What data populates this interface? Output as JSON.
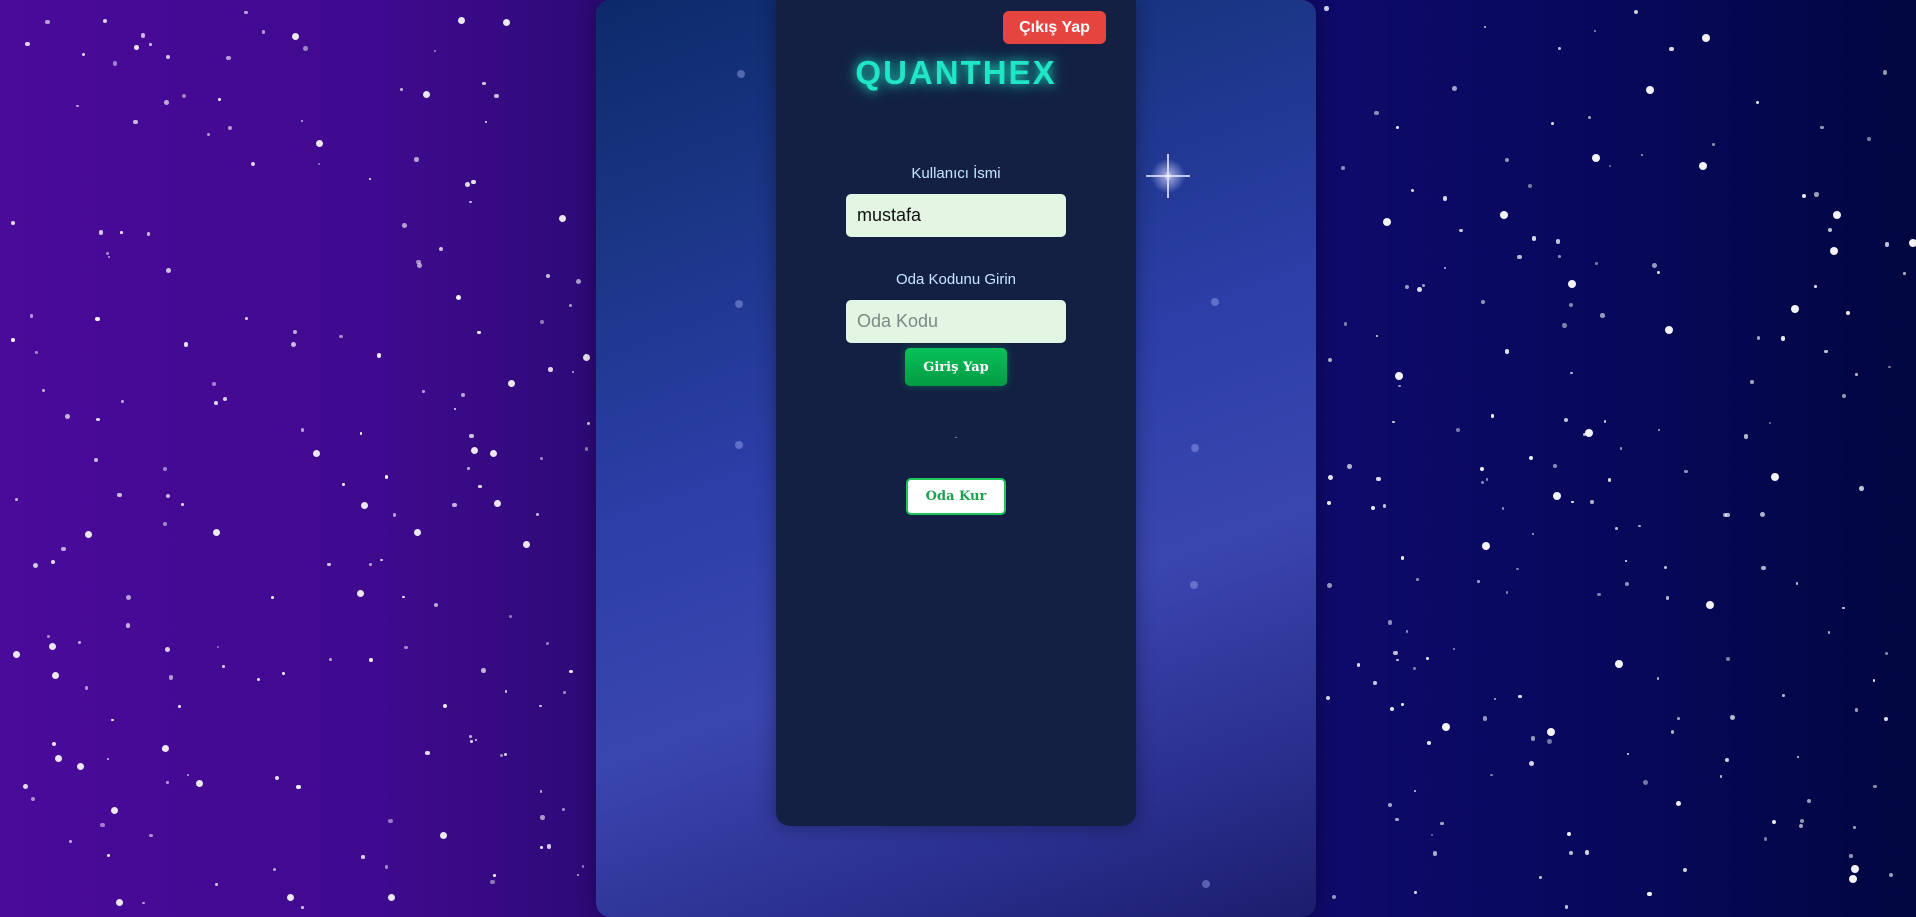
{
  "app": {
    "brand": "QUANTHEX"
  },
  "header": {
    "logout_label": "Çıkış Yap"
  },
  "form": {
    "username_label": "Kullanıcı İsmi",
    "username_value": "mustafa",
    "room_code_label": "Oda Kodunu Girin",
    "room_code_placeholder": "Oda Kodu",
    "room_code_value": "",
    "enter_label": "Giriş Yap",
    "status_text": ".",
    "create_room_label": "Oda Kur"
  },
  "colors": {
    "brand": "#20e6c6",
    "logout": "#e5443f",
    "primary": "#08c25a",
    "card": "#132043",
    "input": "#e3f6e3"
  },
  "icons": [
    "sparkle-star-icon"
  ]
}
